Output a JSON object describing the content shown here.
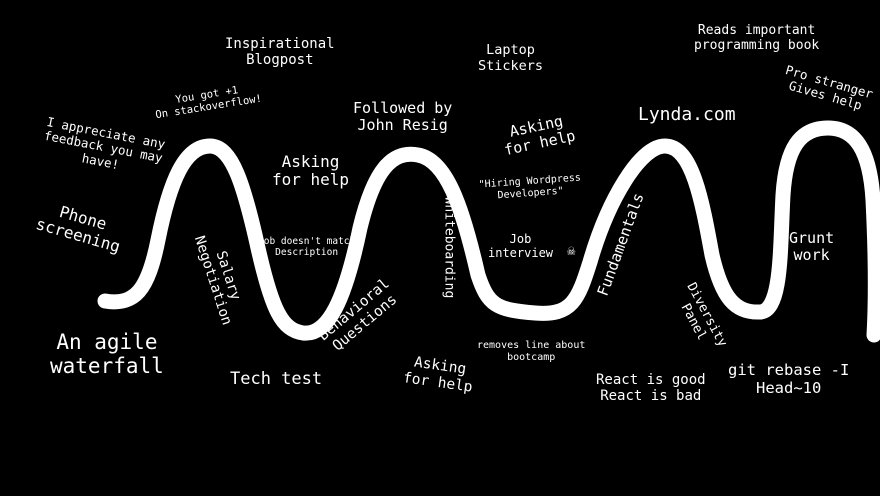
{
  "colors": {
    "background": "#000000",
    "ink": "#ffffff"
  },
  "labels": {
    "inspirational_blogpost": "Inspirational\nBlogpost",
    "laptop_stickers": "Laptop\nStickers",
    "reads_book": "Reads important\nprogramming book",
    "you_got_plus_one": "You got +1\nOn stackoverflow!",
    "appreciate_feedback": "I appreciate any\nfeedback you may\nhave!",
    "followed_by": "Followed by\nJohn Resig",
    "asking_for_help_1": "Asking\nfor help",
    "asking_for_help_2": "Asking\nfor help",
    "asking_for_help_3": "Asking\nfor help",
    "lynda": "Lynda.com",
    "pro_stranger": "Pro stranger\nGives help",
    "phone_screening": "Phone\nscreening",
    "salary_negotiation": "Salary\nNegotiation",
    "job_mismatch": "Job doesn't match\nDescription",
    "whiteboarding": "Whiteboarding",
    "hiring_wordpress": "\"Hiring Wordpress\nDevelopers\"",
    "fundamentals": "Fundamentals",
    "job_interview": "Job\ninterview",
    "grunt_work": "Grunt\nwork",
    "behavioral_questions": "Behavioral\nQuestions",
    "agile_waterfall": "An agile\nwaterfall",
    "tech_test": "Tech test",
    "removes_bootcamp": "removes line about\nbootcamp",
    "diversity_panel": "Diversity\nPanel",
    "react_good_bad": "React is good\nReact is bad",
    "git_rebase": "git rebase -I\nHead~10"
  }
}
